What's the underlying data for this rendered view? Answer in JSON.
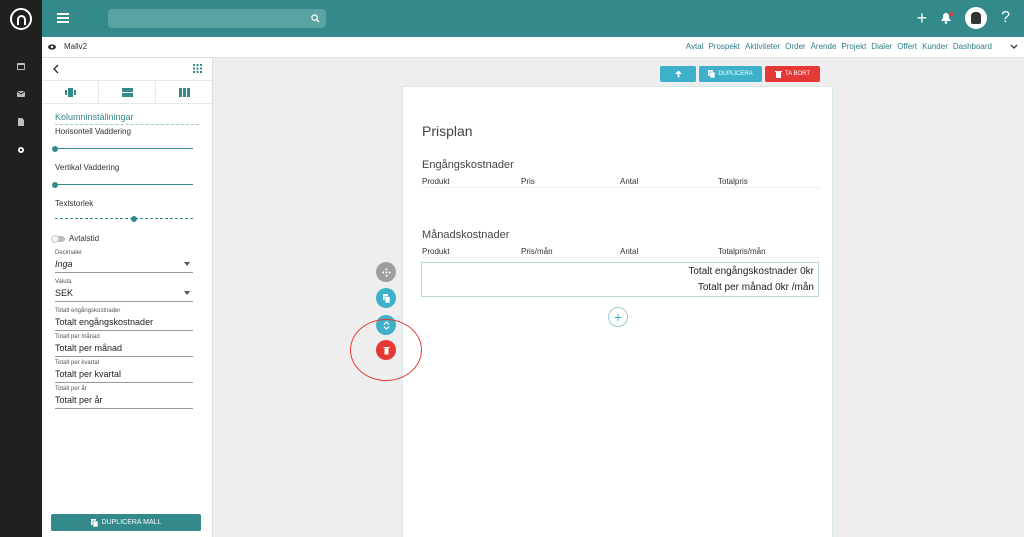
{
  "header": {
    "search_placeholder": ""
  },
  "subheader": {
    "doc_name": "Mallv2",
    "nav": [
      "Avtal",
      "Prospekt",
      "Aktiviteter",
      "Order",
      "Ärende",
      "Projekt",
      "Dialer",
      "Offert",
      "Kunder",
      "Dashboard"
    ]
  },
  "panel": {
    "section_title": "Kolumninställningar",
    "horizontal_padding_label": "Horisontell Vaddering",
    "horizontal_padding_value": 0,
    "vertical_padding_label": "Vertikal Vaddering",
    "vertical_padding_value": 0,
    "text_size_label": "Textstorlek",
    "agreement_time_label": "Avtalstid",
    "agreement_time_enabled": false,
    "decimals_label": "Decimaler",
    "decimals_value": "Inga",
    "currency_label": "Valuta",
    "currency_value": "SEK",
    "total_once_label": "Totalt engångskostnader",
    "total_once_value": "Totalt engångskostnader",
    "total_month_label": "Totalt per månad",
    "total_month_value": "Totalt per månad",
    "total_quarter_label": "Totalt per kvartal",
    "total_quarter_value": "Totalt per kvartal",
    "total_year_label": "Totalt per år",
    "total_year_value": "Totalt per år",
    "duplicate_button": "DUPLICERA MALL"
  },
  "page_actions": {
    "duplicate": "DUPLICERA",
    "delete": "TA BORT"
  },
  "document": {
    "title": "Prisplan",
    "one_time": {
      "title": "Engångskostnader",
      "columns": [
        "Produkt",
        "Pris",
        "Antal",
        "Totalpris"
      ]
    },
    "monthly": {
      "title": "Månadskostnader",
      "columns": [
        "Produkt",
        "Pris/mån",
        "Antal",
        "Totalpris/mån"
      ]
    },
    "totals": {
      "one_time": "Totalt engångskostnader 0kr",
      "monthly": "Totalt per månad 0kr /mån"
    },
    "add_symbol": "+"
  },
  "colors": {
    "brand": "#34898a",
    "accent": "#3fb0c9",
    "danger": "#e53935"
  }
}
